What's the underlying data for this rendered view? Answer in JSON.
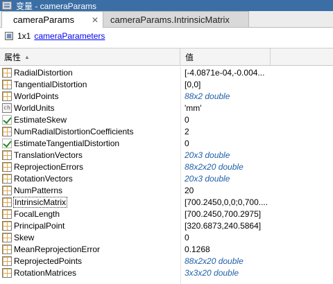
{
  "window": {
    "title": "变量 - cameraParams"
  },
  "tabs": [
    {
      "label": "cameraParams",
      "close": "✕"
    },
    {
      "label": "cameraParams.IntrinsicMatrix"
    }
  ],
  "info": {
    "dims": "1x1",
    "class_link": "cameraParameters"
  },
  "table": {
    "col_name": "属性",
    "col_value": "值",
    "rows": [
      {
        "icon": "matrix-icon",
        "name": "RadialDistortion",
        "value": "[-4.0871e-04,-0.004..."
      },
      {
        "icon": "matrix-icon",
        "name": "TangentialDistortion",
        "value": "[0,0]"
      },
      {
        "icon": "matrix-icon",
        "name": "WorldPoints",
        "value": "88x2 double"
      },
      {
        "icon": "char-icon",
        "name": "WorldUnits",
        "value": "'mm'"
      },
      {
        "icon": "checkbox-icon",
        "name": "EstimateSkew",
        "value": "0"
      },
      {
        "icon": "matrix-icon",
        "name": "NumRadialDistortionCoefficients",
        "value": "2"
      },
      {
        "icon": "checkbox-icon",
        "name": "EstimateTangentialDistortion",
        "value": "0"
      },
      {
        "icon": "matrix-icon",
        "name": "TranslationVectors",
        "value": "20x3 double"
      },
      {
        "icon": "matrix-icon",
        "name": "ReprojectionErrors",
        "value": "88x2x20 double"
      },
      {
        "icon": "matrix-icon",
        "name": "RotationVectors",
        "value": "20x3 double"
      },
      {
        "icon": "matrix-icon",
        "name": "NumPatterns",
        "value": "20"
      },
      {
        "icon": "matrix-icon",
        "name": "IntrinsicMatrix",
        "value": "[700.2450,0,0;0,700...."
      },
      {
        "icon": "matrix-icon",
        "name": "FocalLength",
        "value": "[700.2450,700.2975]"
      },
      {
        "icon": "matrix-icon",
        "name": "PrincipalPoint",
        "value": "[320.6873,240.5864]"
      },
      {
        "icon": "matrix-icon",
        "name": "Skew",
        "value": "0"
      },
      {
        "icon": "matrix-icon",
        "name": "MeanReprojectionError",
        "value": "0.1268"
      },
      {
        "icon": "matrix-icon",
        "name": "ReprojectedPoints",
        "value": "88x2x20 double"
      },
      {
        "icon": "matrix-icon",
        "name": "RotationMatrices",
        "value": "3x3x20 double"
      }
    ]
  }
}
